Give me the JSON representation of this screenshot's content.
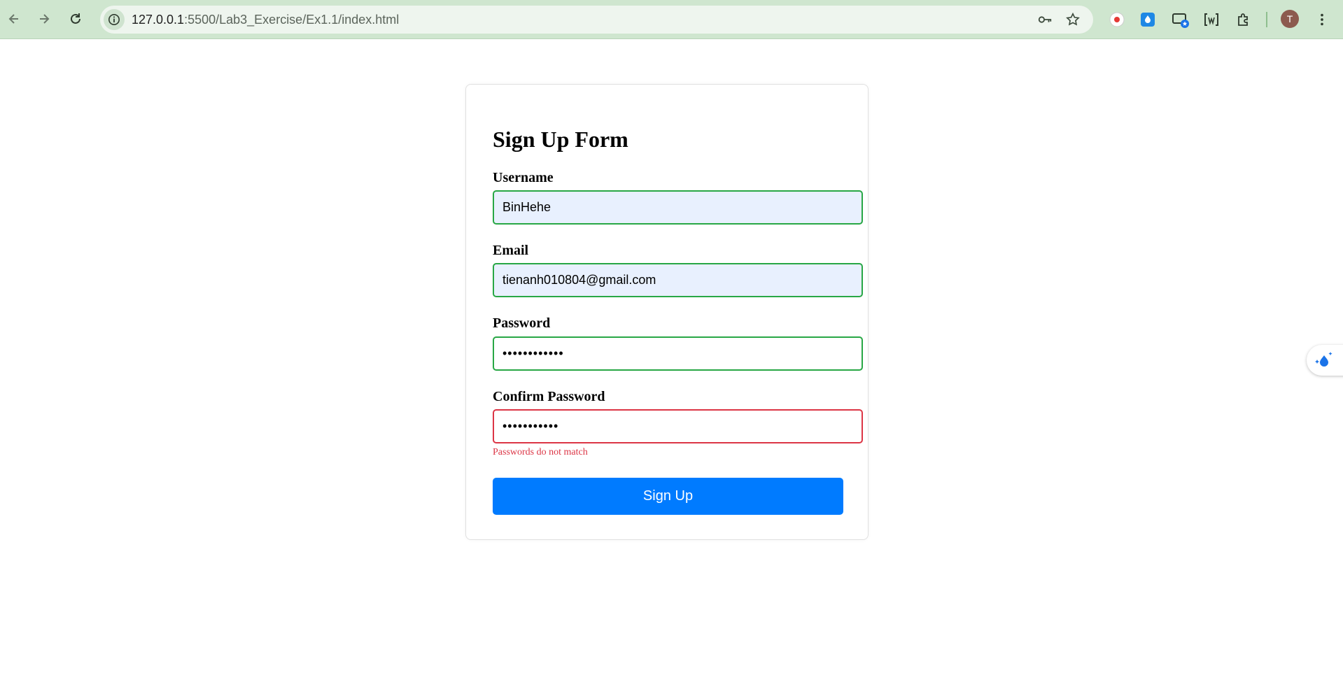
{
  "browser": {
    "url_host": "127.0.0.1",
    "url_path": ":5500/Lab3_Exercise/Ex1.1/index.html",
    "profile_initial": "T",
    "icons": [
      "back-arrow-icon",
      "forward-arrow-icon",
      "reload-icon",
      "site-info-icon",
      "key-icon",
      "star-icon",
      "record-extension-icon",
      "droplet-extension-icon",
      "cast-extension-icon",
      "wappalyzer-extension-icon",
      "puzzle-extensions-icon",
      "kebab-menu-icon"
    ]
  },
  "form": {
    "title": "Sign Up Form",
    "username": {
      "label": "Username",
      "value": "BinHehe"
    },
    "email": {
      "label": "Email",
      "value": "tienanh010804@gmail.com"
    },
    "password": {
      "label": "Password",
      "value": "123456789012"
    },
    "confirm_password": {
      "label": "Confirm Password",
      "value": "12345678901"
    },
    "error": "Passwords do not match",
    "submit_label": "Sign Up"
  },
  "colors": {
    "valid_border": "#28a745",
    "invalid_border": "#dc3545",
    "primary_button": "#007bff",
    "autofill_bg": "#e8f0fe",
    "toolbar_bg": "#cfe6cf"
  }
}
